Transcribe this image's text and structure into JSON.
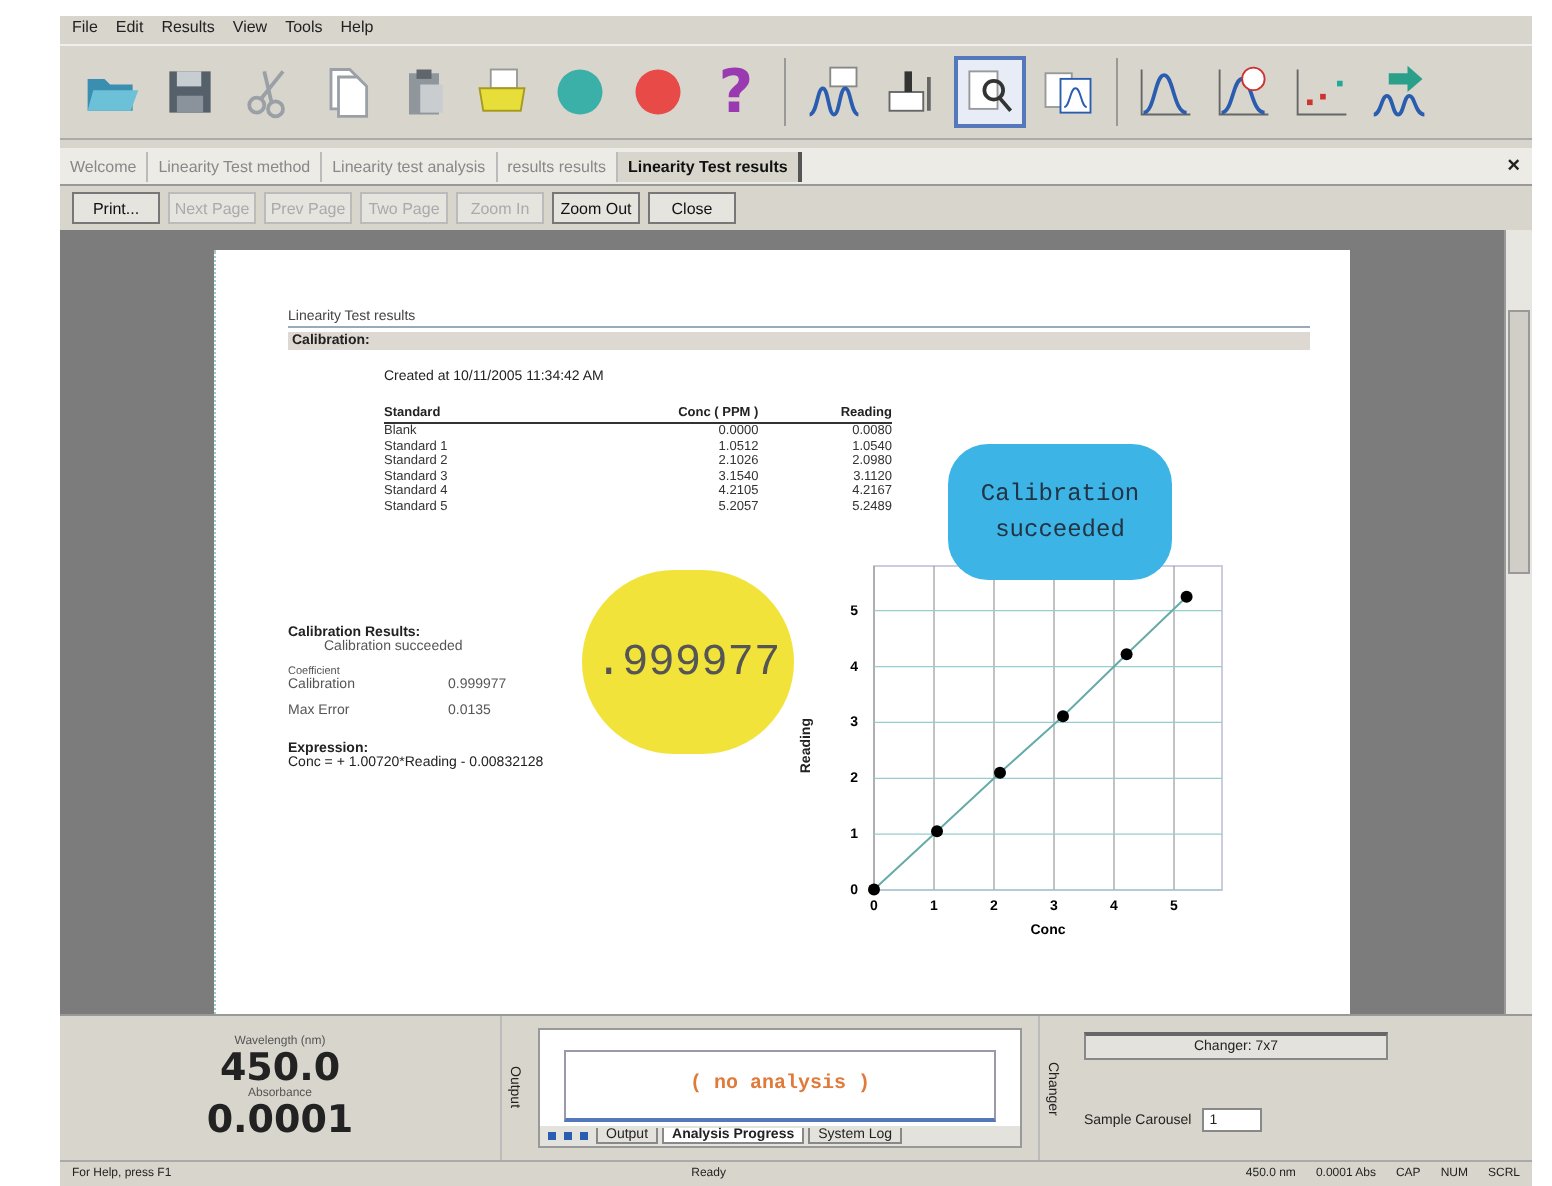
{
  "menu": [
    "File",
    "Edit",
    "Results",
    "View",
    "Tools",
    "Help"
  ],
  "toolbar": [
    {
      "kind": "open",
      "selected": false
    },
    {
      "kind": "save",
      "selected": false
    },
    {
      "kind": "cut",
      "selected": false
    },
    {
      "kind": "copy",
      "selected": false
    },
    {
      "kind": "paste",
      "selected": false
    },
    {
      "kind": "print",
      "selected": false
    },
    {
      "kind": "start",
      "selected": false
    },
    {
      "kind": "stop",
      "selected": false
    },
    {
      "kind": "help",
      "label": "?",
      "selected": false
    },
    {
      "kind": "method",
      "selected": false
    },
    {
      "kind": "instrument",
      "selected": false
    },
    {
      "kind": "inspect",
      "selected": true
    },
    {
      "kind": "report",
      "selected": false
    },
    {
      "kind": "peak",
      "selected": false
    },
    {
      "kind": "peak-time",
      "selected": false
    },
    {
      "kind": "scatter",
      "selected": false
    },
    {
      "kind": "export",
      "selected": false
    }
  ],
  "document_tabs": [
    {
      "label": "Welcome",
      "selected": false
    },
    {
      "label": "Linearity Test method",
      "selected": false
    },
    {
      "label": "Linearity test analysis",
      "selected": false
    },
    {
      "label": "results results",
      "selected": false
    },
    {
      "label": "Linearity Test results",
      "selected": true
    }
  ],
  "close_glyph": "×",
  "preview_buttons": [
    {
      "label": "Print...",
      "disabled": false
    },
    {
      "label": "Next Page",
      "disabled": true
    },
    {
      "label": "Prev Page",
      "disabled": true
    },
    {
      "label": "Two Page",
      "disabled": true
    },
    {
      "label": "Zoom In",
      "disabled": true
    },
    {
      "label": "Zoom Out",
      "disabled": false
    },
    {
      "label": "Close",
      "disabled": false
    }
  ],
  "report": {
    "header": "Linearity Test results",
    "section": "Calibration:",
    "created": "Created at 10/11/2005 11:34:42 AM",
    "table": {
      "columns": [
        "Standard",
        "Conc ( PPM )",
        "Reading"
      ],
      "rows": [
        [
          "Blank",
          "0.0000",
          "0.0080"
        ],
        [
          "Standard 1",
          "1.0512",
          "1.0540"
        ],
        [
          "Standard 2",
          "2.1026",
          "2.0980"
        ],
        [
          "Standard 3",
          "3.1540",
          "3.1120"
        ],
        [
          "Standard 4",
          "4.2105",
          "4.2167"
        ],
        [
          "Standard 5",
          "5.2057",
          "5.2489"
        ]
      ]
    },
    "results_title": "Calibration Results:",
    "results_status": "Calibration succeeded",
    "metrics": [
      {
        "label": "Calibration",
        "note": "Coefficient",
        "value": "0.999977"
      },
      {
        "label": "Max Error",
        "value": "0.0135"
      }
    ],
    "expression_title": "Expression:",
    "expression": "Conc = + 1.00720*Reading - 0.00832128",
    "chart_data": {
      "type": "line",
      "xlabel": "Conc",
      "ylabel": "Reading",
      "xlim": [
        0,
        5.8
      ],
      "ylim": [
        0,
        5.8
      ],
      "xticks": [
        0,
        1,
        2,
        3,
        4,
        5
      ],
      "yticks": [
        0,
        1,
        2,
        3,
        4,
        5
      ],
      "grid": true,
      "series": [
        {
          "color": "#000000",
          "marker": "circle",
          "x": [
            0,
            1.05,
            2.1,
            3.15,
            4.21,
            5.21
          ],
          "values": [
            0.01,
            1.05,
            2.1,
            3.11,
            4.22,
            5.25
          ]
        }
      ]
    },
    "callouts": [
      {
        "kind": "circle",
        "text": ".999977",
        "color": "#f2e33a"
      },
      {
        "kind": "box",
        "text": "Calibration succeeded",
        "color": "#3db4e6"
      }
    ]
  },
  "readout": [
    {
      "label": "Wavelength (nm)",
      "value": "450.0"
    },
    {
      "label": "Absorbance",
      "value": "0.0001"
    }
  ],
  "output_panel": {
    "side_label": "Output",
    "message": "( no analysis )",
    "tabs": [
      {
        "label": "Output",
        "selected": false
      },
      {
        "label": "Analysis Progress",
        "selected": true
      },
      {
        "label": "System Log",
        "selected": false
      }
    ]
  },
  "changer_panel": {
    "side_label": "Changer",
    "changer": "Changer: 7x7",
    "carousel_label": "Sample Carousel",
    "carousel_value": "1"
  },
  "status_bar": [
    "For Help, press F1",
    "Ready",
    "450.0 nm",
    "0.0001 Abs",
    "CAP",
    "NUM",
    "SCRL"
  ]
}
